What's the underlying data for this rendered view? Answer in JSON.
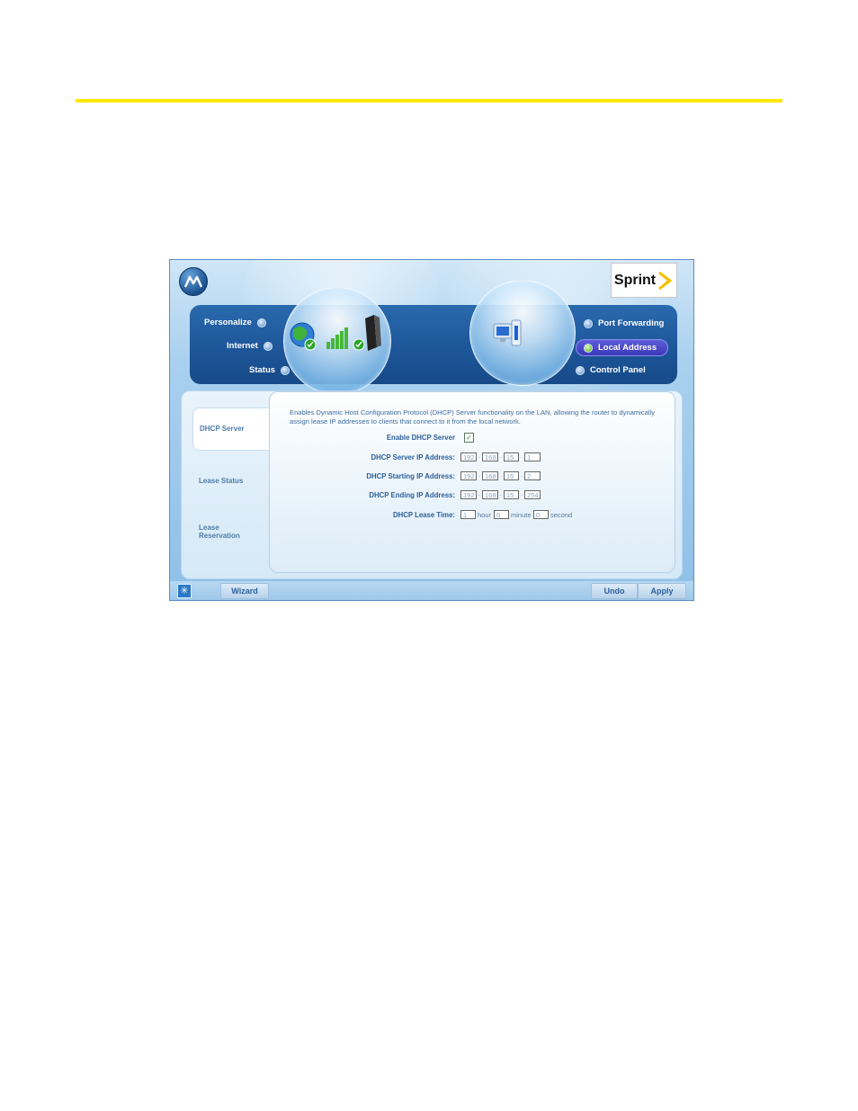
{
  "brand": {
    "carrier": "Sprint"
  },
  "nav": {
    "left": [
      {
        "label": "Personalize"
      },
      {
        "label": "Internet"
      },
      {
        "label": "Status"
      }
    ],
    "right": [
      {
        "label": "Port Forwarding"
      },
      {
        "label": "Local Address",
        "active": true
      },
      {
        "label": "Control Panel"
      }
    ]
  },
  "sidebar": {
    "items": [
      {
        "label": "DHCP Server",
        "active": true
      },
      {
        "label": "Lease Status"
      },
      {
        "label": "Lease Reservation"
      }
    ]
  },
  "dhcp": {
    "description": "Enables Dynamic Host Configuration Protocol (DHCP) Server functionality on the LAN, allowing the router to dynamically assign lease IP addresses to clients that connect to it from the local network.",
    "enable_label": "Enable DHCP Server",
    "enabled": true,
    "server_ip_label": "DHCP Server IP Address:",
    "server_ip": [
      "192",
      "168",
      "15",
      "1"
    ],
    "start_ip_label": "DHCP Starting IP Address:",
    "start_ip": [
      "192",
      "168",
      "15",
      "2"
    ],
    "end_ip_label": "DHCP Ending IP Address:",
    "end_ip": [
      "192",
      "168",
      "15",
      "254"
    ],
    "lease_label": "DHCP Lease Time:",
    "lease_hour": "1",
    "lease_hour_unit": "hour",
    "lease_minute": "0",
    "lease_minute_unit": "minute",
    "lease_second": "0",
    "lease_second_unit": "second"
  },
  "footer": {
    "wizard": "Wizard",
    "undo": "Undo",
    "apply": "Apply"
  },
  "colors": {
    "rule": "#ffe600",
    "nav_bg": "#1c5598",
    "active_tab": "#4b4bc9",
    "label": "#2c5f9a"
  }
}
